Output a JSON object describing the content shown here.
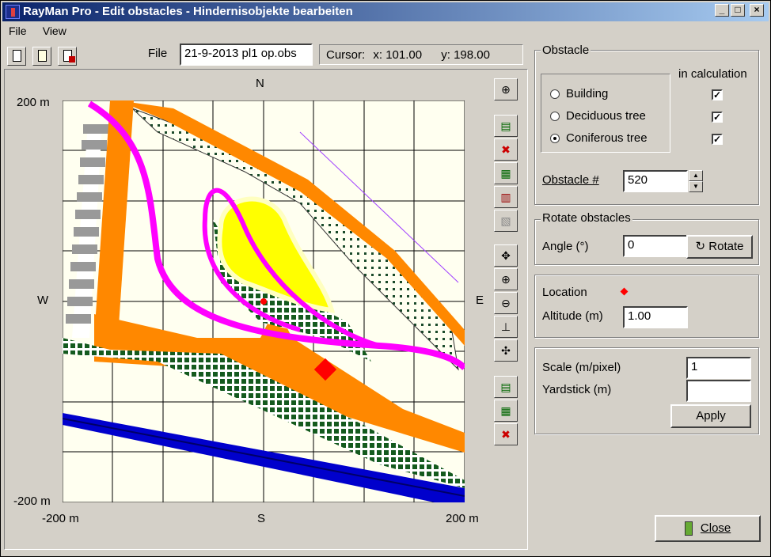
{
  "window": {
    "title": "RayMan Pro - Edit obstacles - Hindernisobjekte bearbeiten"
  },
  "menu": [
    "File",
    "View"
  ],
  "toolbar": {
    "file_label": "File",
    "file_value": "21-9-2013 pl1 op.obs"
  },
  "cursor": {
    "label": "Cursor:",
    "x": "x: 101.00",
    "y": "y: 198.00"
  },
  "map": {
    "north": "N",
    "south": "S",
    "west": "W",
    "east": "E",
    "y_top": "200 m",
    "y_bottom": "-200 m",
    "x_left": "-200 m",
    "x_right": "200 m"
  },
  "obstacle": {
    "title": "Obstacle",
    "in_calc_label": "in calculation",
    "types": [
      {
        "label": "Building",
        "selected": false,
        "in_calc": true
      },
      {
        "label": "Deciduous tree",
        "selected": false,
        "in_calc": true
      },
      {
        "label": "Coniferous tree",
        "selected": true,
        "in_calc": true
      }
    ],
    "number_label": "Obstacle #",
    "number_value": "520"
  },
  "rotate": {
    "title": "Rotate obstacles",
    "angle_label": "Angle (°)",
    "angle_value": "0",
    "button": "Rotate"
  },
  "location": {
    "label": "Location",
    "altitude_label": "Altitude (m)",
    "altitude_value": "1.00"
  },
  "scale": {
    "scale_label": "Scale (m/pixel)",
    "scale_value": "1",
    "yardstick_label": "Yardstick (m)",
    "yardstick_value": "",
    "apply": "Apply"
  },
  "close": "Close"
}
